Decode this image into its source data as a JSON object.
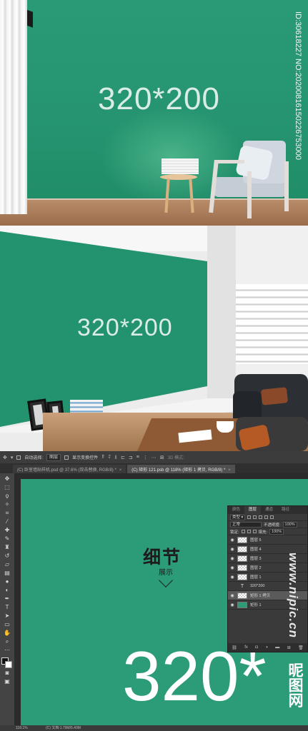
{
  "scene1": {
    "size_text": "320*200",
    "watermark_id": "ID:30618227 NO:20200816150226753000"
  },
  "scene2": {
    "size_text": "320*200"
  },
  "photoshop": {
    "options_bar": {
      "auto_select_label": "自动选择:",
      "auto_select_value": "图层",
      "show_transform_label": "显示变换控件",
      "mode_3d_label": "3D 模式:"
    },
    "tabs": [
      {
        "label": "(C) 卧室墙贴样机.psd @ 37.6% (双击替换, RGB/8) *",
        "close": "×"
      },
      {
        "label": "(C) 矩形 121.psb @ 118% (矩形 1 拷贝, RGB/8) *",
        "close": "×"
      }
    ],
    "canvas": {
      "title": "细节",
      "subtitle": "展示",
      "size_text": "320*"
    },
    "status_bar": {
      "zoom": "118.1%",
      "doc_info": "(C) 文档:1.79M/5.40M"
    },
    "layers_panel": {
      "tabs": [
        "颜色",
        "图层",
        "通道",
        "路径"
      ],
      "active_tab": "图层",
      "filter_label": "类型",
      "blend_mode": "正常",
      "opacity_label": "不透明度:",
      "opacity_value": "100%",
      "lock_label": "锁定:",
      "fill_label": "填充:",
      "fill_value": "100%",
      "layers": [
        {
          "name": "图层 5",
          "thumb": "checker",
          "selected": false
        },
        {
          "name": "图层 4",
          "thumb": "checker",
          "selected": false
        },
        {
          "name": "图层 3",
          "thumb": "checker",
          "selected": false
        },
        {
          "name": "图层 2",
          "thumb": "checker",
          "selected": false
        },
        {
          "name": "图层 1",
          "thumb": "checker",
          "selected": false
        },
        {
          "name": "320*200",
          "thumb": "text",
          "selected": false
        },
        {
          "name": "矩形 1 拷贝",
          "thumb": "checker",
          "selected": true
        },
        {
          "name": "矩形 1",
          "thumb": "green",
          "selected": false
        }
      ],
      "footer_icons": [
        "link-icon",
        "fx-icon",
        "mask-icon",
        "adjustment-icon",
        "folder-icon",
        "new-layer-icon",
        "trash-icon"
      ],
      "footer_fx": "fx"
    },
    "watermark_site": "www.nipic.cn",
    "watermark_cn": "昵图网"
  }
}
